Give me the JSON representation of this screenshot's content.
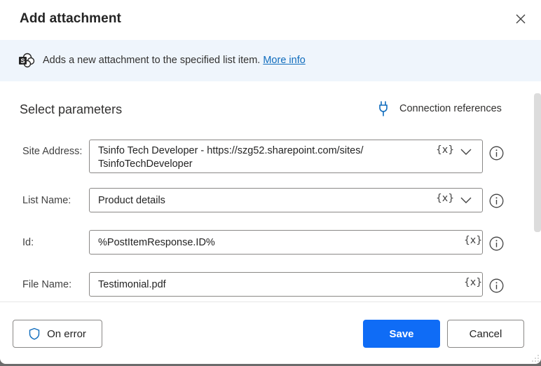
{
  "dialog": {
    "title": "Add attachment",
    "close_icon": "close-icon"
  },
  "banner": {
    "icon": "sharepoint-icon",
    "description": "Adds a new attachment to the specified list item.",
    "link_label": "More info"
  },
  "parameters": {
    "section_title": "Select parameters",
    "connection_references_label": "Connection references",
    "connection_icon": "plug-icon",
    "fields": [
      {
        "label": "Site Address:",
        "value_line1": "Tsinfo Tech Developer - https://szg52.sharepoint.com/sites/",
        "value_line2": "TsinfoTechDeveloper",
        "variable_button": "{x}",
        "has_dropdown": true
      },
      {
        "label": "List Name:",
        "value": "Product details",
        "variable_button": "{x}",
        "has_dropdown": true
      },
      {
        "label": "Id:",
        "value": "%PostItemResponse.ID%",
        "variable_button": "{x}",
        "has_dropdown": false
      },
      {
        "label": "File Name:",
        "value": "Testimonial.pdf",
        "variable_button": "{x}",
        "has_dropdown": false
      }
    ]
  },
  "footer": {
    "on_error_label": "On error",
    "save_label": "Save",
    "cancel_label": "Cancel"
  },
  "colors": {
    "primary": "#0f6cf6",
    "link": "#0f6cbd",
    "banner_bg": "#eff5fc"
  }
}
